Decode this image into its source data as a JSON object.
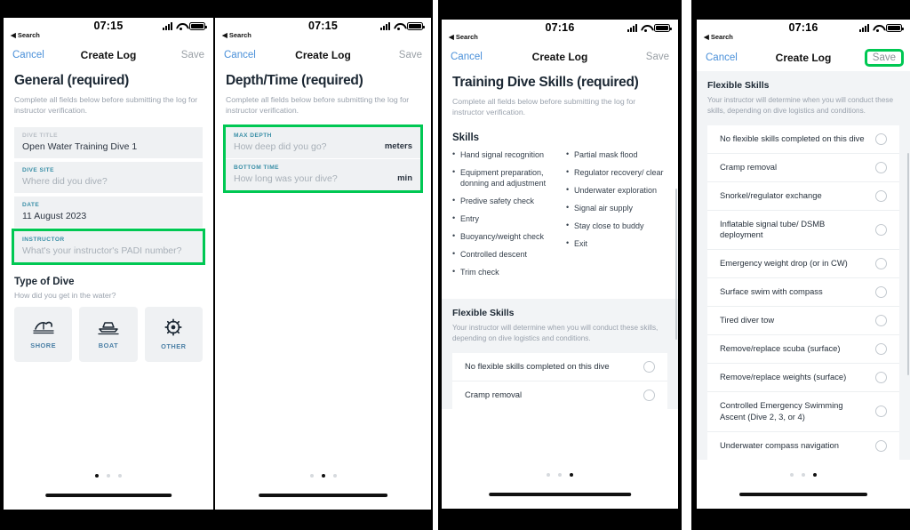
{
  "accent": {
    "green_highlight": "#00c853",
    "link_blue": "#4a90d9",
    "label_teal": "#3a8fa7"
  },
  "panels": [
    {
      "status": {
        "time": "07:15",
        "back_label": "◀ Search"
      },
      "nav": {
        "cancel": "Cancel",
        "title": "Create Log",
        "save": "Save",
        "save_highlighted": false
      },
      "section_title": "General (required)",
      "helper": "Complete all fields below before submitting the log for instructor verification.",
      "fields": [
        {
          "label": "DIVE TITLE",
          "value": "Open Water Training Dive 1",
          "placeholder": false,
          "label_muted": true,
          "highlight": false
        },
        {
          "label": "DIVE SITE",
          "value": "Where did you dive?",
          "placeholder": true,
          "label_muted": false,
          "highlight": false
        },
        {
          "label": "DATE",
          "value": "11 August 2023",
          "placeholder": false,
          "label_muted": false,
          "highlight": false
        },
        {
          "label": "INSTRUCTOR",
          "value": "What's your instructor's PADI number?",
          "placeholder": true,
          "label_muted": false,
          "highlight": true
        }
      ],
      "type_of_dive": {
        "title": "Type of Dive",
        "help": "How did you get in the water?",
        "options": [
          {
            "label": "SHORE",
            "icon": "shore-icon"
          },
          {
            "label": "BOAT",
            "icon": "boat-icon"
          },
          {
            "label": "OTHER",
            "icon": "compass-icon"
          }
        ]
      },
      "pager": {
        "count": 3,
        "active": 0
      }
    },
    {
      "status": {
        "time": "07:15",
        "back_label": "◀ Search"
      },
      "nav": {
        "cancel": "Cancel",
        "title": "Create Log",
        "save": "Save",
        "save_highlighted": false
      },
      "section_title": "Depth/Time (required)",
      "helper": "Complete all fields below before submitting the log for instructor verification.",
      "fields": [
        {
          "label": "MAX DEPTH",
          "value": "How deep did you go?",
          "unit": "meters",
          "placeholder": true,
          "label_muted": false
        },
        {
          "label": "BOTTOM TIME",
          "value": "How long was your dive?",
          "unit": "min",
          "placeholder": true,
          "label_muted": false
        }
      ],
      "fields_group_highlighted": true,
      "pager": {
        "count": 3,
        "active": 1
      }
    },
    {
      "status": {
        "time": "07:16",
        "back_label": "◀ Search"
      },
      "nav": {
        "cancel": "Cancel",
        "title": "Create Log",
        "save": "Save",
        "save_highlighted": false
      },
      "section_title": "Training Dive Skills (required)",
      "helper": "Complete all fields below before submitting the log for instructor verification.",
      "skills_heading": "Skills",
      "skills_col1": [
        "Hand signal recognition",
        "Equipment preparation, donning and adjustment",
        "Predive safety check",
        "Entry",
        "Buoyancy/weight check",
        "Controlled descent",
        "Trim check"
      ],
      "skills_col2": [
        "Partial mask flood",
        "Regulator recovery/ clear",
        "Underwater exploration",
        "Signal air supply",
        "Stay close to buddy",
        "Exit"
      ],
      "flexible": {
        "heading": "Flexible Skills",
        "help": "Your instructor will determine when you will conduct these skills, depending on dive logistics and conditions.",
        "items": [
          "No flexible skills completed on this dive",
          "Cramp removal"
        ]
      },
      "pager": {
        "count": 3,
        "active": 2
      }
    },
    {
      "status": {
        "time": "07:16",
        "back_label": "◀ Search"
      },
      "nav": {
        "cancel": "Cancel",
        "title": "Create Log",
        "save": "Save",
        "save_highlighted": true
      },
      "flexible": {
        "heading": "Flexible Skills",
        "help": "Your instructor will determine when you will conduct these skills, depending on dive logistics and conditions.",
        "items": [
          "No flexible skills completed on this dive",
          "Cramp removal",
          "Snorkel/regulator exchange",
          "Inflatable signal tube/ DSMB deployment",
          "Emergency weight drop (or in CW)",
          "Surface swim with compass",
          "Tired diver tow",
          "Remove/replace scuba (surface)",
          "Remove/replace weights (surface)",
          "Controlled Emergency Swimming Ascent (Dive 2, 3, or 4)",
          "Underwater compass navigation"
        ]
      },
      "pager": {
        "count": 3,
        "active": 2
      }
    }
  ]
}
